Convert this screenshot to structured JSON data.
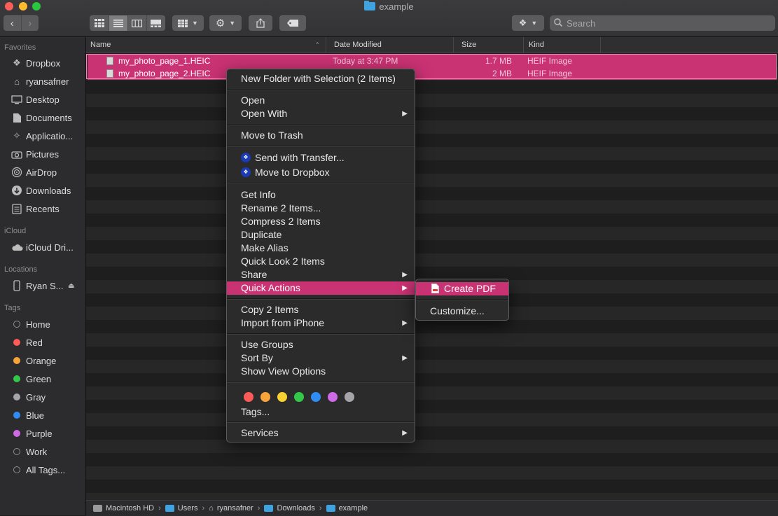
{
  "window": {
    "title": "example"
  },
  "toolbar": {
    "search_placeholder": "Search",
    "view_modes": [
      "icon-view",
      "list-view",
      "column-view",
      "gallery-view"
    ]
  },
  "sidebar": {
    "favorites_label": "Favorites",
    "favorites": [
      {
        "label": "Dropbox",
        "icon": "dropbox-icon"
      },
      {
        "label": "ryansafner",
        "icon": "home-icon"
      },
      {
        "label": "Desktop",
        "icon": "desktop-icon"
      },
      {
        "label": "Documents",
        "icon": "documents-icon"
      },
      {
        "label": "Applicatio...",
        "icon": "applications-icon"
      },
      {
        "label": "Pictures",
        "icon": "camera-icon"
      },
      {
        "label": "AirDrop",
        "icon": "airdrop-icon"
      },
      {
        "label": "Downloads",
        "icon": "downloads-icon"
      },
      {
        "label": "Recents",
        "icon": "recents-icon"
      }
    ],
    "icloud_label": "iCloud",
    "icloud": [
      {
        "label": "iCloud Dri...",
        "icon": "cloud-icon"
      }
    ],
    "locations_label": "Locations",
    "locations": [
      {
        "label": "Ryan S...",
        "icon": "phone-icon"
      }
    ],
    "tags_label": "Tags",
    "tags": [
      {
        "label": "Home",
        "color": "#2c2c2e"
      },
      {
        "label": "Red",
        "color": "#fc5b57"
      },
      {
        "label": "Orange",
        "color": "#f9a43b"
      },
      {
        "label": "Green",
        "color": "#34c84a"
      },
      {
        "label": "Gray",
        "color": "#a5a5a9"
      },
      {
        "label": "Blue",
        "color": "#2f8cf5"
      },
      {
        "label": "Purple",
        "color": "#ce6ae6"
      },
      {
        "label": "Work",
        "color": "#2c2c2e"
      },
      {
        "label": "All Tags...",
        "color": "#2c2c2e"
      }
    ]
  },
  "columns": {
    "name": "Name",
    "date": "Date Modified",
    "size": "Size",
    "kind": "Kind"
  },
  "files": [
    {
      "name": "my_photo_page_1.HEIC",
      "date": "Today at 3:47 PM",
      "size": "1.7 MB",
      "kind": "HEIF Image"
    },
    {
      "name": "my_photo_page_2.HEIC",
      "date": "",
      "size": "2 MB",
      "kind": "HEIF Image"
    }
  ],
  "pathbar": [
    "Macintosh HD",
    "Users",
    "ryansafner",
    "Downloads",
    "example"
  ],
  "context_menu": {
    "new_folder": "New Folder with Selection (2 Items)",
    "open": "Open",
    "open_with": "Open With",
    "move_trash": "Move to Trash",
    "send_transfer": "Send with Transfer...",
    "move_dropbox": "Move to Dropbox",
    "get_info": "Get Info",
    "rename": "Rename 2 Items...",
    "compress": "Compress 2 Items",
    "duplicate": "Duplicate",
    "make_alias": "Make Alias",
    "quick_look": "Quick Look 2 Items",
    "share": "Share",
    "quick_actions": "Quick Actions",
    "copy": "Copy 2 Items",
    "import_iphone": "Import from iPhone",
    "use_groups": "Use Groups",
    "sort_by": "Sort By",
    "show_view_options": "Show View Options",
    "tag_colors": [
      "#fc5b57",
      "#f9a43b",
      "#f7d230",
      "#34c84a",
      "#2f8cf5",
      "#ce6ae6",
      "#a5a5a9"
    ],
    "tags": "Tags...",
    "services": "Services"
  },
  "submenu": {
    "create_pdf": "Create PDF",
    "customize": "Customize..."
  }
}
